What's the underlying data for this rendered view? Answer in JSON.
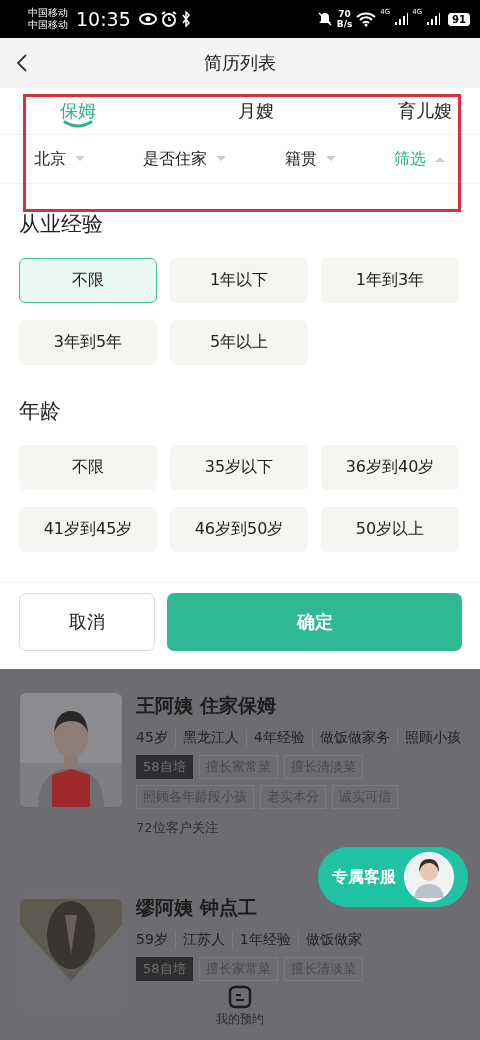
{
  "status_bar": {
    "carriers": [
      "中国移动",
      "中国移动"
    ],
    "time": "10:35",
    "speed_value": "70",
    "speed_unit": "B/s",
    "networks": [
      "4G",
      "4G"
    ],
    "battery": "91"
  },
  "header": {
    "title": "简历列表"
  },
  "tabs": [
    {
      "label": "保姆",
      "selected": true
    },
    {
      "label": "月嫂",
      "selected": false
    },
    {
      "label": "育儿嫂",
      "selected": false
    }
  ],
  "filters": [
    {
      "label": "北京",
      "expanded": false
    },
    {
      "label": "是否住家",
      "expanded": false
    },
    {
      "label": "籍贯",
      "expanded": false
    },
    {
      "label": "筛选",
      "expanded": true
    }
  ],
  "sections": [
    {
      "title": "从业经验",
      "options": [
        {
          "label": "不限",
          "selected": true
        },
        {
          "label": "1年以下",
          "selected": false
        },
        {
          "label": "1年到3年",
          "selected": false
        },
        {
          "label": "3年到5年",
          "selected": false
        },
        {
          "label": "5年以上",
          "selected": false
        }
      ]
    },
    {
      "title": "年龄",
      "options": [
        {
          "label": "不限",
          "selected": false
        },
        {
          "label": "35岁以下",
          "selected": false
        },
        {
          "label": "36岁到40岁",
          "selected": false
        },
        {
          "label": "41岁到45岁",
          "selected": false
        },
        {
          "label": "46岁到50岁",
          "selected": false
        },
        {
          "label": "50岁以上",
          "selected": false
        }
      ]
    }
  ],
  "buttons": [
    {
      "label": "取消",
      "kind": "secondary"
    },
    {
      "label": "确定",
      "kind": "primary"
    }
  ],
  "cards": [
    {
      "name": "王阿姨 住家保姆",
      "details": [
        "45岁",
        "黑龙江人",
        "4年经验",
        "做饭做家务",
        "照顾小孩"
      ],
      "tags": [
        {
          "label": "58自培",
          "kind": "training"
        },
        {
          "label": "擅长家常菜",
          "kind": "skill"
        },
        {
          "label": "擅长清淡菜",
          "kind": "skill"
        },
        {
          "label": "照顾各年龄段小孩",
          "kind": "skill"
        },
        {
          "label": "老实本分",
          "kind": "skill"
        },
        {
          "label": "诚实可信",
          "kind": "skill"
        }
      ],
      "followers": "72位客户关注",
      "photo": {
        "kind": "picture"
      }
    },
    {
      "name": "缪阿姨 钟点工",
      "details": [
        "59岁",
        "江苏人",
        "1年经验",
        "做饭做家"
      ],
      "tags": [
        {
          "label": "58自培",
          "kind": "training"
        },
        {
          "label": "擅长家常菜",
          "kind": "skill"
        },
        {
          "label": "擅长清淡菜",
          "kind": "skill"
        }
      ],
      "photo": {
        "kind": "picture"
      }
    }
  ],
  "service_button": {
    "label": "专属客服"
  },
  "bottom_nav": {
    "label": "我的预约"
  }
}
